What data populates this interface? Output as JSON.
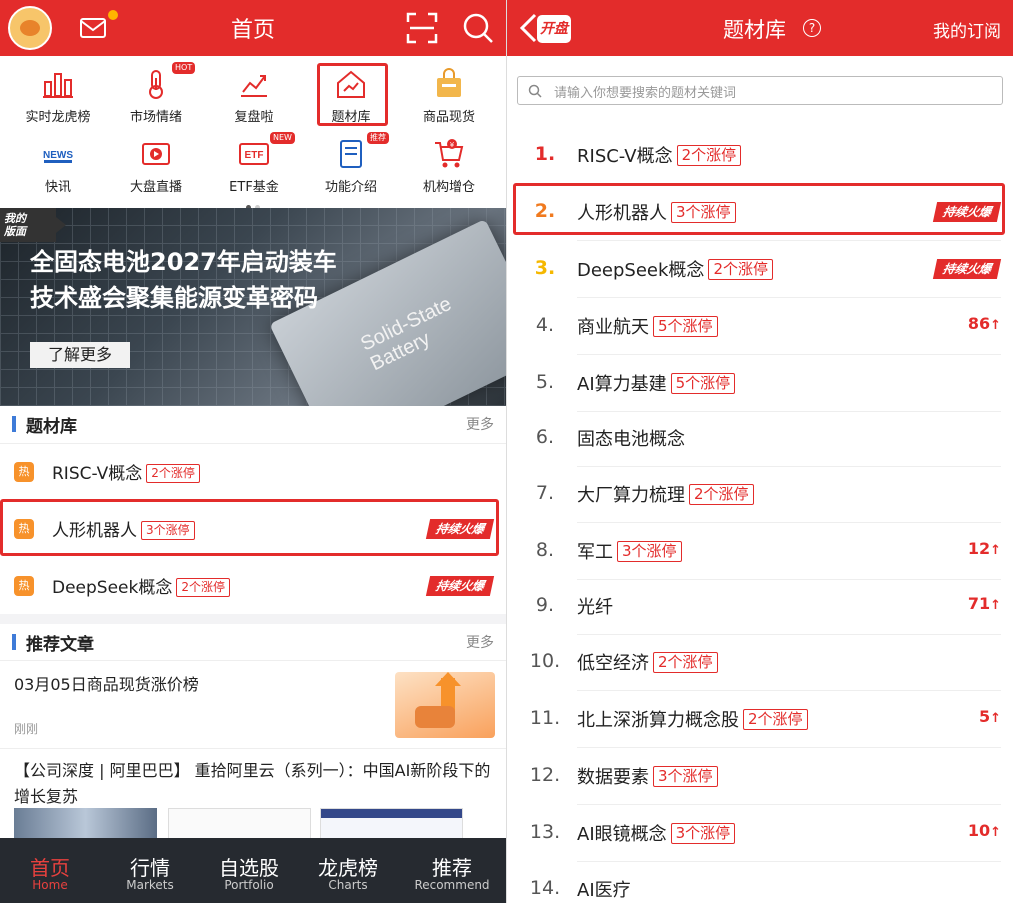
{
  "left": {
    "header": {
      "title": "首页"
    },
    "shortcuts": [
      {
        "label": "实时龙虎榜",
        "icon": "bar-chart-icon"
      },
      {
        "label": "市场情绪",
        "icon": "thermometer-icon",
        "badge": "HOT"
      },
      {
        "label": "复盘啦",
        "icon": "trend-chart-icon"
      },
      {
        "label": "题材库",
        "icon": "house-trend-icon"
      },
      {
        "label": "商品现货",
        "icon": "shopping-bag-icon"
      },
      {
        "label": "快讯",
        "icon": "news-icon",
        "icon_text": "NEWS"
      },
      {
        "label": "大盘直播",
        "icon": "play-icon"
      },
      {
        "label": "ETF基金",
        "icon": "etf-icon",
        "badge": "NEW",
        "icon_text": "ETF"
      },
      {
        "label": "功能介绍",
        "icon": "book-icon",
        "badge": "推荐"
      },
      {
        "label": "机构增仓",
        "icon": "cart-icon"
      }
    ],
    "banner": {
      "tag": "我的\n版面",
      "headline_1": "全固态电池2027年启动装车",
      "headline_2": "技术盛会聚集能源变革密码",
      "button": "了解更多",
      "image_text_1": "Solid-State",
      "image_text_2": "Battery"
    },
    "topic_section": {
      "title": "题材库",
      "more": "更多"
    },
    "topics": [
      {
        "hot": "热",
        "name": "RISC-V概念",
        "tag": "2个涨停",
        "fire": ""
      },
      {
        "hot": "热",
        "name": "人形机器人",
        "tag": "3个涨停",
        "fire": "持续火爆"
      },
      {
        "hot": "热",
        "name": "DeepSeek概念",
        "tag": "2个涨停",
        "fire": "持续火爆"
      }
    ],
    "article_section": {
      "title": "推荐文章",
      "more": "更多"
    },
    "articles": [
      {
        "title": "03月05日商品现货涨价榜",
        "time": "刚刚"
      },
      {
        "title": "【公司深度 | 阿里巴巴】 重拾阿里云（系列一）：中国AI新阶段下的增长复苏"
      }
    ],
    "tabs": [
      {
        "zh": "首页",
        "en": "Home"
      },
      {
        "zh": "行情",
        "en": "Markets"
      },
      {
        "zh": "自选股",
        "en": "Portfolio"
      },
      {
        "zh": "龙虎榜",
        "en": "Charts"
      },
      {
        "zh": "推荐",
        "en": "Recommend"
      }
    ]
  },
  "right": {
    "header": {
      "back_brand": "开盘",
      "title": "题材库",
      "help": "?",
      "subscribe": "我的订阅"
    },
    "search": {
      "placeholder": "请输入你想要搜索的题材关键词"
    },
    "items": [
      {
        "rank": "1.",
        "name": "RISC-V概念",
        "tag": "2个涨停",
        "right": ""
      },
      {
        "rank": "2.",
        "name": "人形机器人",
        "tag": "3个涨停",
        "fire": "持续火爆"
      },
      {
        "rank": "3.",
        "name": "DeepSeek概念",
        "tag": "2个涨停",
        "fire": "持续火爆"
      },
      {
        "rank": "4.",
        "name": "商业航天",
        "tag": "5个涨停",
        "count": "86"
      },
      {
        "rank": "5.",
        "name": "AI算力基建",
        "tag": "5个涨停"
      },
      {
        "rank": "6.",
        "name": "固态电池概念",
        "tag": ""
      },
      {
        "rank": "7.",
        "name": "大厂算力梳理",
        "tag": "2个涨停"
      },
      {
        "rank": "8.",
        "name": "军工",
        "tag": "3个涨停",
        "count": "12"
      },
      {
        "rank": "9.",
        "name": "光纤",
        "tag": "",
        "count": "71"
      },
      {
        "rank": "10.",
        "name": "低空经济",
        "tag": "2个涨停"
      },
      {
        "rank": "11.",
        "name": "北上深浙算力概念股",
        "tag": "2个涨停",
        "count": "5"
      },
      {
        "rank": "12.",
        "name": "数据要素",
        "tag": "3个涨停"
      },
      {
        "rank": "13.",
        "name": "AI眼镜概念",
        "tag": "3个涨停",
        "count": "10"
      },
      {
        "rank": "14.",
        "name": "AI医疗",
        "tag": ""
      }
    ]
  },
  "colors": {
    "brand_red": "#e32c2b",
    "hot_orange": "#f7922b",
    "tabbar_bg": "#262a30"
  }
}
